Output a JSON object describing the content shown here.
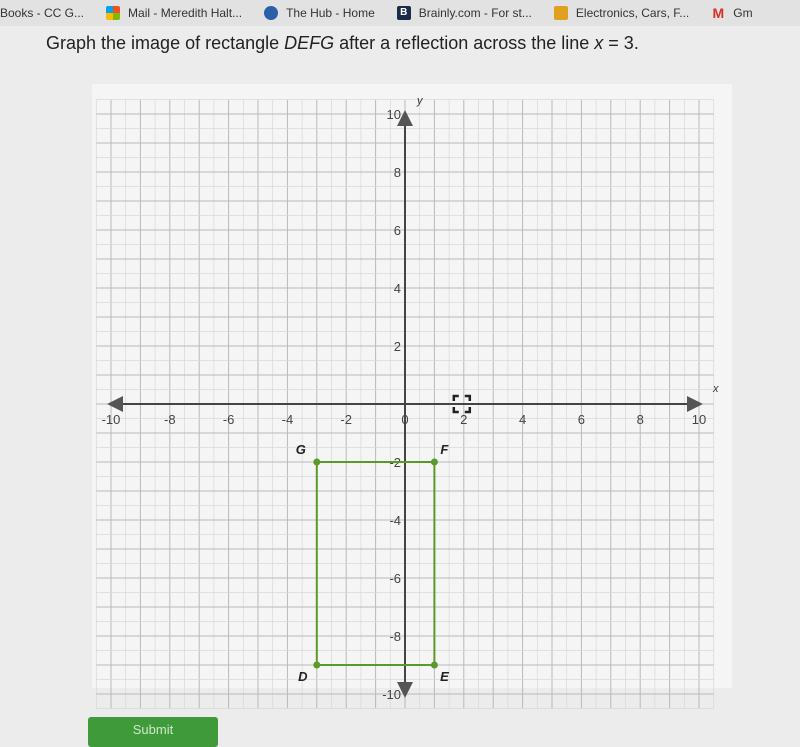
{
  "bookmarks": [
    {
      "label": "Books - CC G...",
      "icon": "bookmark-icon"
    },
    {
      "label": "Mail - Meredith Halt...",
      "icon": "microsoft-mail-icon"
    },
    {
      "label": "The Hub - Home",
      "icon": "hub-icon"
    },
    {
      "label": "Brainly.com - For st...",
      "icon": "brainly-icon",
      "glyph": "B"
    },
    {
      "label": "Electronics, Cars, F...",
      "icon": "ebay-bag-icon"
    },
    {
      "label": "Gm",
      "icon": "gmail-icon",
      "glyph": "M"
    }
  ],
  "question": {
    "prefix": "Graph the image of rectangle ",
    "shape_name": "DEFG",
    "middle": " after a reflection across the line ",
    "var": "x",
    "suffix": " = 3."
  },
  "submit_label": "Submit",
  "chart_data": {
    "type": "scatter",
    "title": "",
    "xlabel": "x",
    "ylabel": "y",
    "xlim": [
      -10,
      10
    ],
    "ylim": [
      -10,
      10
    ],
    "grid": true,
    "x_ticks": [
      -10,
      -8,
      -6,
      -4,
      -2,
      0,
      2,
      4,
      6,
      8,
      10
    ],
    "y_ticks": [
      -10,
      -8,
      -6,
      -4,
      -2,
      2,
      4,
      6,
      8,
      10
    ],
    "polygon": {
      "name": "DEFG",
      "color": "#5a9a2a",
      "vertices": [
        {
          "label": "D",
          "x": -3,
          "y": -9
        },
        {
          "label": "E",
          "x": 1,
          "y": -9
        },
        {
          "label": "F",
          "x": 1,
          "y": -2
        },
        {
          "label": "G",
          "x": -3,
          "y": -2
        }
      ]
    },
    "cursor_point": {
      "x": 2,
      "y": 0,
      "icon": "move-cursor-icon"
    }
  }
}
